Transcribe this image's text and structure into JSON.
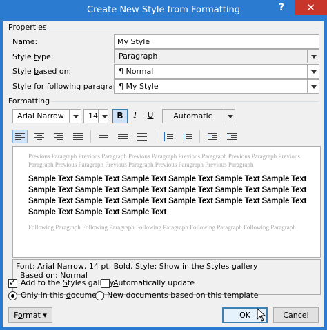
{
  "window": {
    "title": "Create New Style from Formatting",
    "help_label": "?",
    "close_label": "✕"
  },
  "properties": {
    "group_label": "Properties",
    "name_label_pre": "N",
    "name_label_u": "a",
    "name_label_post": "me:",
    "name_value": "My Style",
    "type_label_pre": "Style ",
    "type_label_u": "t",
    "type_label_post": "ype:",
    "type_value": "Paragraph",
    "based_label_pre": "Style ",
    "based_label_u": "b",
    "based_label_post": "ased on:",
    "based_value": "¶  Normal",
    "following_label_pre": "",
    "following_label_u": "S",
    "following_label_post": "tyle for following paragraph:",
    "following_value": "¶  My Style"
  },
  "formatting": {
    "group_label": "Formatting",
    "font": "Arial Narrow",
    "size": "14",
    "bold": "B",
    "italic": "I",
    "underline": "U",
    "color": "Automatic"
  },
  "preview": {
    "previous_line1": "Previous Paragraph Previous Paragraph Previous Paragraph Previous Paragraph Previous Paragraph Previous",
    "previous_line2": "Paragraph Previous Paragraph Previous Paragraph Previous Paragraph Previous Paragraph",
    "sample_line1": "Sample Text Sample Text Sample Text Sample Text Sample Text Sample Text",
    "sample_line2": "Sample Text Sample Text Sample Text Sample Text Sample Text Sample Text",
    "sample_line3": "Sample Text Sample Text Sample Text Sample Text Sample Text Sample Text",
    "sample_line4": "Sample Text Sample Text Sample Text",
    "following_line1": "Following Paragraph Following Paragraph Following Paragraph Following Paragraph Following Paragraph"
  },
  "description": {
    "line1": "Font: Arial Narrow, 14 pt, Bold, Style: Show in the Styles gallery",
    "line2": "Based on: Normal"
  },
  "options": {
    "add_gallery_pre": "Add to the ",
    "add_gallery_u": "S",
    "add_gallery_post": "tyles gallery",
    "add_gallery_checked": true,
    "auto_update_pre": "",
    "auto_update_u": "A",
    "auto_update_post": "utomatically update",
    "auto_update_checked": false,
    "only_doc_pre": "Only in this ",
    "only_doc_u": "d",
    "only_doc_post": "ocument",
    "new_docs_pre": "New documents based on this template",
    "scope_selected": "only_this_document"
  },
  "buttons": {
    "format_pre": "F",
    "format_u": "o",
    "format_post": "rmat",
    "format_arrow": "▾",
    "ok": "OK",
    "cancel": "Cancel"
  },
  "colors": {
    "titlebar": "#2b7bd1",
    "close": "#c7352b",
    "dialog_bg": "#f0f0f0",
    "selected_button": "#cfe2f7"
  }
}
